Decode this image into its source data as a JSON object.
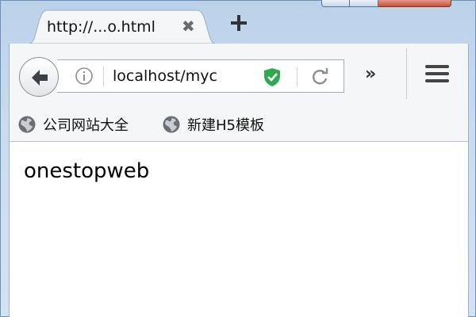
{
  "tab": {
    "title": "http://...o.html",
    "close_glyph": "✖",
    "new_tab_icon": "plus-icon"
  },
  "toolbar": {
    "back_icon": "arrow-left-icon",
    "url": "localhost/myc",
    "info_icon": "info-icon",
    "security_icon": "shield-check-icon",
    "reload_icon": "reload-icon",
    "overflow_label": "»",
    "menu_icon": "hamburger-icon"
  },
  "bookmarks": [
    {
      "label": "公司网站大全",
      "icon": "globe-icon"
    },
    {
      "label": "新建H5模板",
      "icon": "globe-icon"
    }
  ],
  "page": {
    "text": "onestopweb"
  },
  "colors": {
    "shield": "#2fa84f",
    "close_button": "#c7503a",
    "frame": "#c9dcf0"
  }
}
